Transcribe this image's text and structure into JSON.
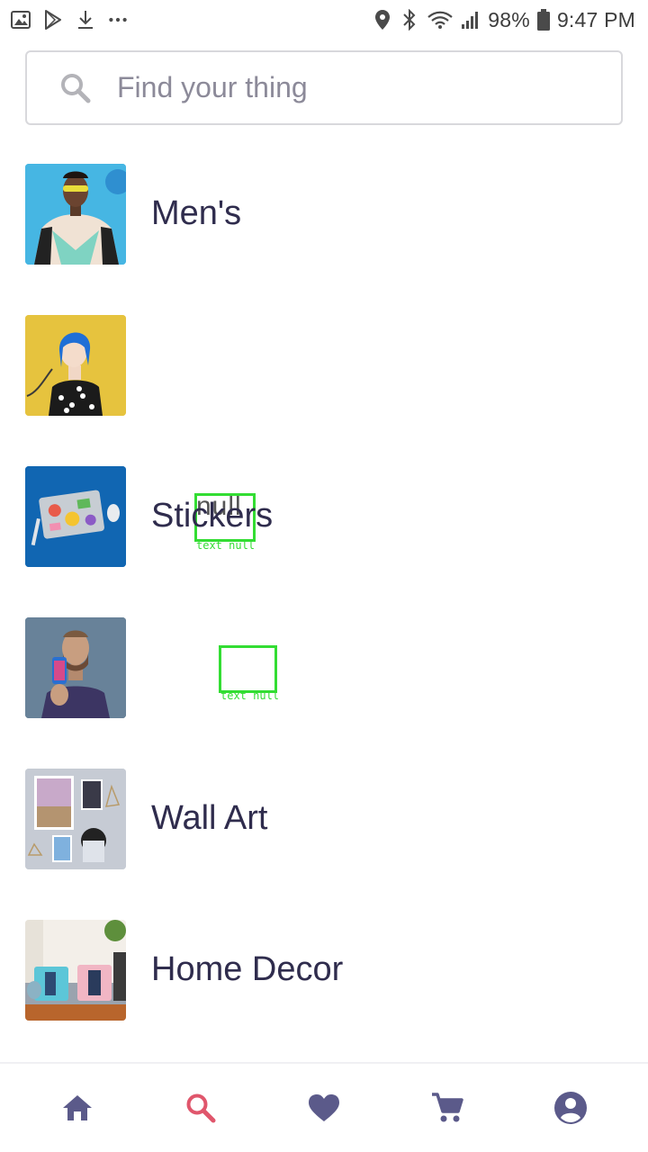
{
  "status_bar": {
    "battery": "98%",
    "time": "9:47 PM",
    "icons_left": [
      "image-icon",
      "play-store-icon",
      "download-icon",
      "more-dots-icon"
    ],
    "icons_right": [
      "location-icon",
      "bluetooth-icon",
      "wifi-icon",
      "signal-icon",
      "battery-icon"
    ]
  },
  "search": {
    "placeholder": "Find your thing"
  },
  "categories": [
    {
      "label": "Men's",
      "thumb": "mens-thumbnail"
    },
    {
      "label": "",
      "thumb": "womens-thumbnail",
      "overlay_text": "null",
      "overlay_tag": "text null"
    },
    {
      "label": "Stickers",
      "thumb": "stickers-thumbnail"
    },
    {
      "label": "",
      "thumb": "phone-case-thumbnail",
      "overlay_tag": "text null"
    },
    {
      "label": "Wall Art",
      "thumb": "wall-art-thumbnail"
    },
    {
      "label": "Home Decor",
      "thumb": "home-decor-thumbnail"
    }
  ],
  "bottom_nav": [
    {
      "name": "home",
      "icon": "home-icon",
      "color": "#5b5a8a"
    },
    {
      "name": "search",
      "icon": "search-icon",
      "color": "#e0566c",
      "active": true
    },
    {
      "name": "favorites",
      "icon": "heart-icon",
      "color": "#5b5a8a"
    },
    {
      "name": "cart",
      "icon": "cart-icon",
      "color": "#5b5a8a"
    },
    {
      "name": "account",
      "icon": "account-icon",
      "color": "#5b5a8a"
    }
  ],
  "colors": {
    "text_primary": "#2f2c4d",
    "nav_inactive": "#5b5a8a",
    "nav_active": "#e0566c",
    "debug_box": "#33dd33"
  }
}
